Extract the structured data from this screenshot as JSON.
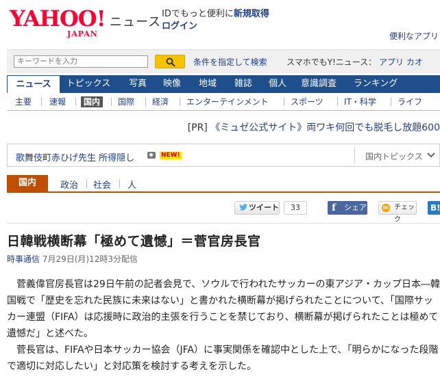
{
  "header": {
    "logo_main": "YAHOO!",
    "logo_sub": "JAPAN",
    "service_name": "ニュース",
    "login_prompt_prefix": "IDでもっと便利に",
    "login_prompt_link": "新規取得",
    "login_link": "ログイン",
    "tool_link": "便利なアプリ"
  },
  "search": {
    "placeholder": "キーワードを入力",
    "advanced_label": "条件を指定して検索",
    "smartphone_label": "スマホでもY!ニュース：",
    "app_link": "アプリ",
    "kao_link": "カオ"
  },
  "main_nav": [
    {
      "label": "ニュース",
      "active": true
    },
    {
      "label": "トピックス"
    },
    {
      "label": "写真"
    },
    {
      "label": "映像"
    },
    {
      "label": "地域"
    },
    {
      "label": "雑誌"
    },
    {
      "label": "個人"
    },
    {
      "label": "意識調査"
    },
    {
      "label": "ランキング"
    }
  ],
  "sub_nav": [
    {
      "label": "主要"
    },
    {
      "label": "速報"
    },
    {
      "label": "国内",
      "active": true
    },
    {
      "label": "国際"
    },
    {
      "label": "経済"
    },
    {
      "label": "エンターテインメント"
    },
    {
      "label": "スポーツ"
    },
    {
      "label": "IT・科学"
    },
    {
      "label": "ライフ"
    }
  ],
  "pr": {
    "tag": "[PR]",
    "text": "《ミュゼ公式サイト》両ワキ何回でも脱毛し放題600"
  },
  "topic_bar": {
    "link": "歌舞伎町赤ひげ先生 所得隠し",
    "badge": "NEW!",
    "dropdown_label": "国内トピックス"
  },
  "category": {
    "active": "国内",
    "items": [
      "政治",
      "社会",
      "人"
    ]
  },
  "social": {
    "tweet_label": "ツイート",
    "tweet_count": "33",
    "share_label": "シェア",
    "check_label": "チェック",
    "hatena_label": "B!"
  },
  "article": {
    "headline": "日韓戦横断幕「極めて遺憾」＝菅官房長官",
    "source": "時事通信",
    "date": "7月29日(月)12時3分配信",
    "para1": "菅義偉官房長官は29日午前の記者会見で、ソウルで行われたサッカーの東アジア・カップ日本―韓国戦で「歴史を忘れた民族に未来はない」と書かれた横断幕が掲げられたことについて、「国際サッカー連盟（FIFA）は応援時に政治的主張を行うことを禁じており、横断幕が掲げられたことは極めて遺憾だ」と述べた。",
    "para2": "菅長官は、FIFAや日本サッカー協会（JFA）に事実関係を確認中とした上で、「明らかになった段階で適切に対応したい」と対応策を検討する考えを示した。"
  },
  "colors": {
    "brand_red": "#ff0033",
    "nav_blue": "#1e4e8c",
    "link_blue": "#1e3e8c",
    "category_orange": "#bf4f00",
    "search_yellow": "#f5c300"
  }
}
